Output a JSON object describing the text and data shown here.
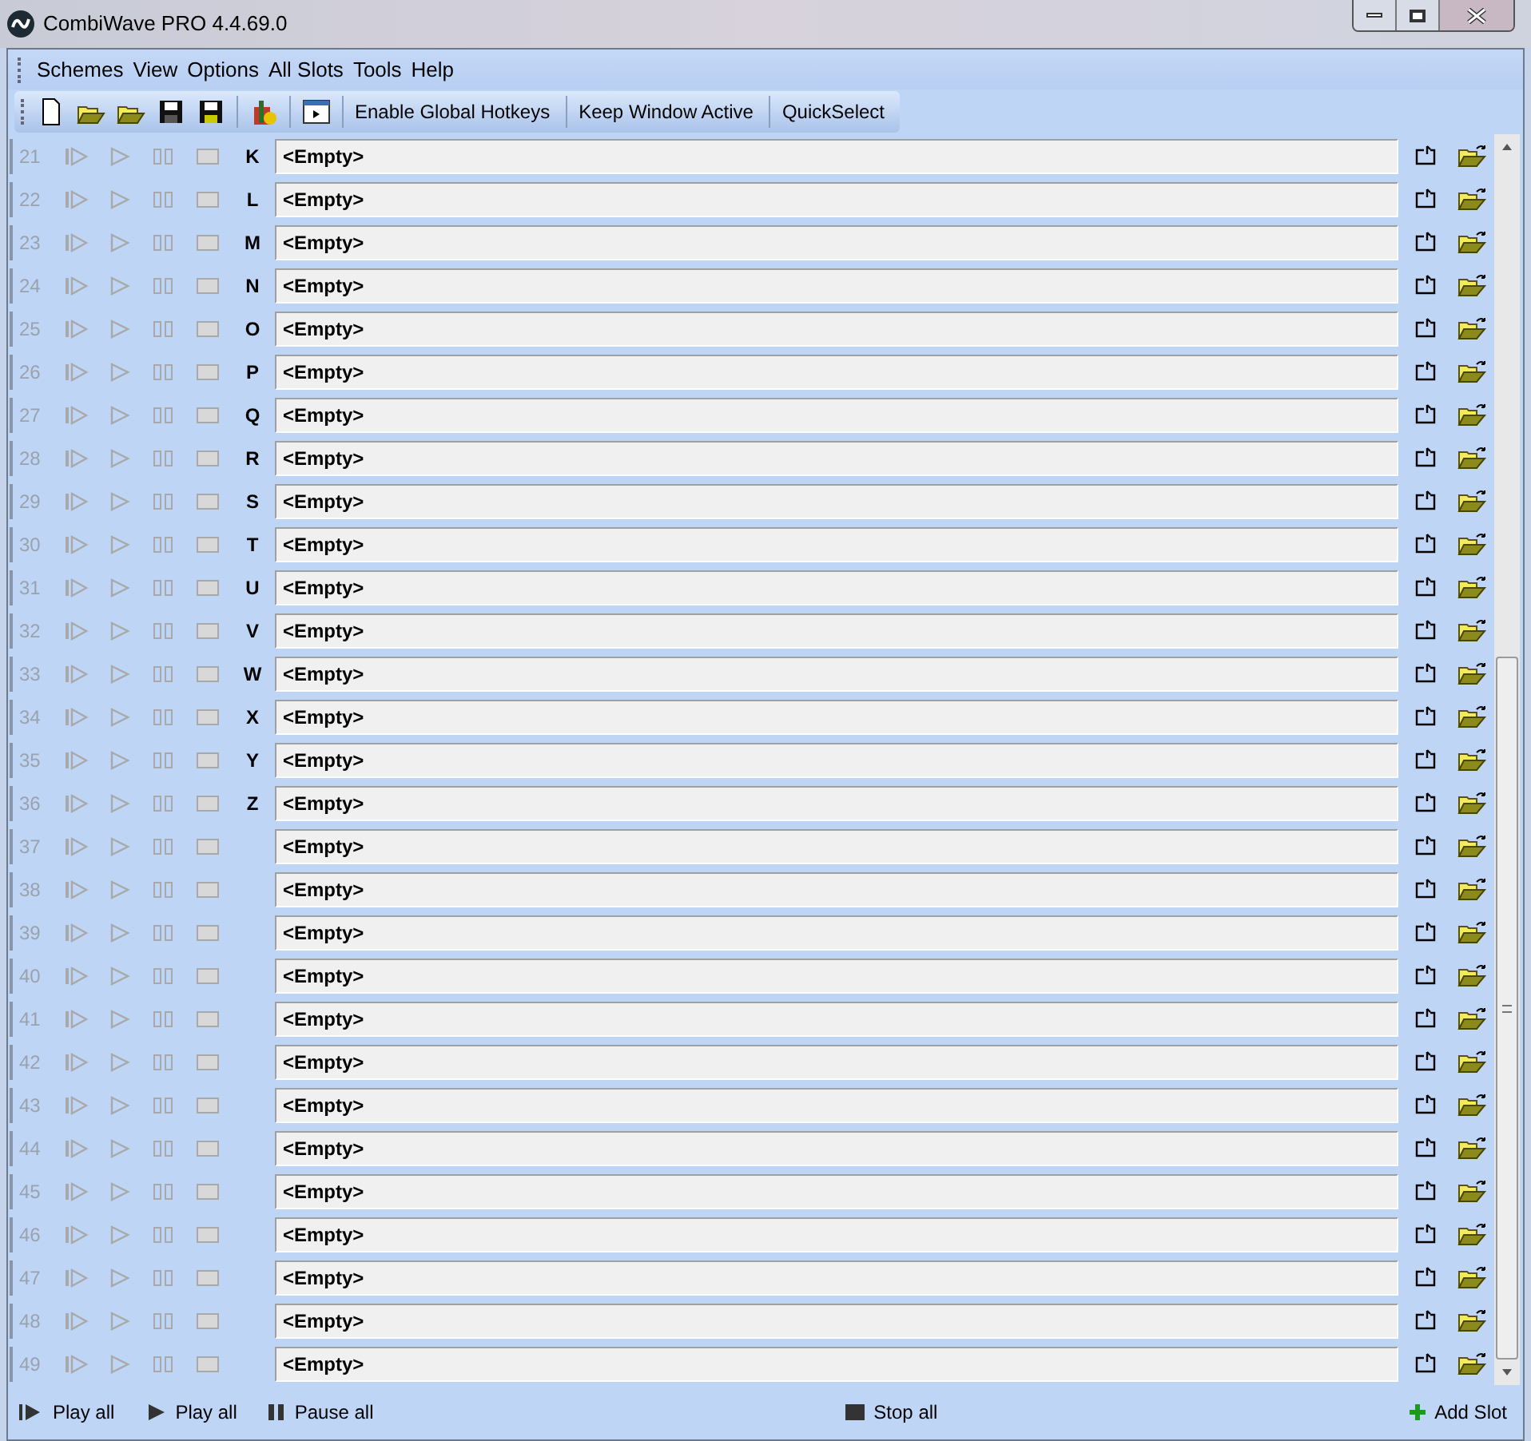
{
  "window": {
    "title": "CombiWave PRO 4.4.69.0"
  },
  "menu": [
    "Schemes",
    "View",
    "Options",
    "All Slots",
    "Tools",
    "Help"
  ],
  "toolbar": {
    "buttons": [
      "Enable Global Hotkeys",
      "Keep Window Active",
      "QuickSelect"
    ]
  },
  "slots": [
    {
      "number": "21",
      "key": "K",
      "name": "<Empty>",
      "disabled": true
    },
    {
      "number": "22",
      "key": "L",
      "name": "<Empty>",
      "disabled": true
    },
    {
      "number": "23",
      "key": "M",
      "name": "<Empty>",
      "disabled": true
    },
    {
      "number": "24",
      "key": "N",
      "name": "<Empty>",
      "disabled": true
    },
    {
      "number": "25",
      "key": "O",
      "name": "<Empty>",
      "disabled": true
    },
    {
      "number": "26",
      "key": "P",
      "name": "<Empty>",
      "disabled": true
    },
    {
      "number": "27",
      "key": "Q",
      "name": "<Empty>",
      "disabled": true
    },
    {
      "number": "28",
      "key": "R",
      "name": "<Empty>",
      "disabled": true
    },
    {
      "number": "29",
      "key": "S",
      "name": "<Empty>",
      "disabled": true
    },
    {
      "number": "30",
      "key": "T",
      "name": "<Empty>",
      "disabled": true
    },
    {
      "number": "31",
      "key": "U",
      "name": "<Empty>",
      "disabled": true
    },
    {
      "number": "32",
      "key": "V",
      "name": "<Empty>",
      "disabled": true
    },
    {
      "number": "33",
      "key": "W",
      "name": "<Empty>",
      "disabled": true
    },
    {
      "number": "34",
      "key": "X",
      "name": "<Empty>",
      "disabled": true
    },
    {
      "number": "35",
      "key": "Y",
      "name": "<Empty>",
      "disabled": true
    },
    {
      "number": "36",
      "key": "Z",
      "name": "<Empty>",
      "disabled": true
    },
    {
      "number": "37",
      "name": "<Empty>",
      "disabled": true
    },
    {
      "number": "38",
      "name": "<Empty>",
      "disabled": true
    },
    {
      "number": "39",
      "name": "<Empty>",
      "disabled": true
    },
    {
      "number": "40",
      "name": "<Empty>",
      "disabled": true
    },
    {
      "number": "41",
      "name": "<Empty>",
      "disabled": true
    },
    {
      "number": "42",
      "name": "<Empty>",
      "disabled": true
    },
    {
      "number": "43",
      "name": "<Empty>",
      "disabled": true
    },
    {
      "number": "44",
      "name": "<Empty>",
      "disabled": true
    },
    {
      "number": "45",
      "name": "<Empty>",
      "disabled": true
    },
    {
      "number": "46",
      "name": "<Empty>",
      "disabled": true
    },
    {
      "number": "47",
      "name": "<Empty>",
      "disabled": true
    },
    {
      "number": "48",
      "name": "<Empty>",
      "disabled": true
    },
    {
      "number": "49",
      "name": "<Empty>",
      "disabled": true
    }
  ],
  "footer": [
    {
      "kind": "play-seq",
      "label": "Play all"
    },
    {
      "kind": "play",
      "label": "Play all"
    },
    {
      "kind": "pause",
      "label": "Pause all"
    },
    {
      "kind": "stop",
      "label": "Stop all"
    },
    {
      "kind": "add",
      "label": "Add Slot"
    }
  ]
}
